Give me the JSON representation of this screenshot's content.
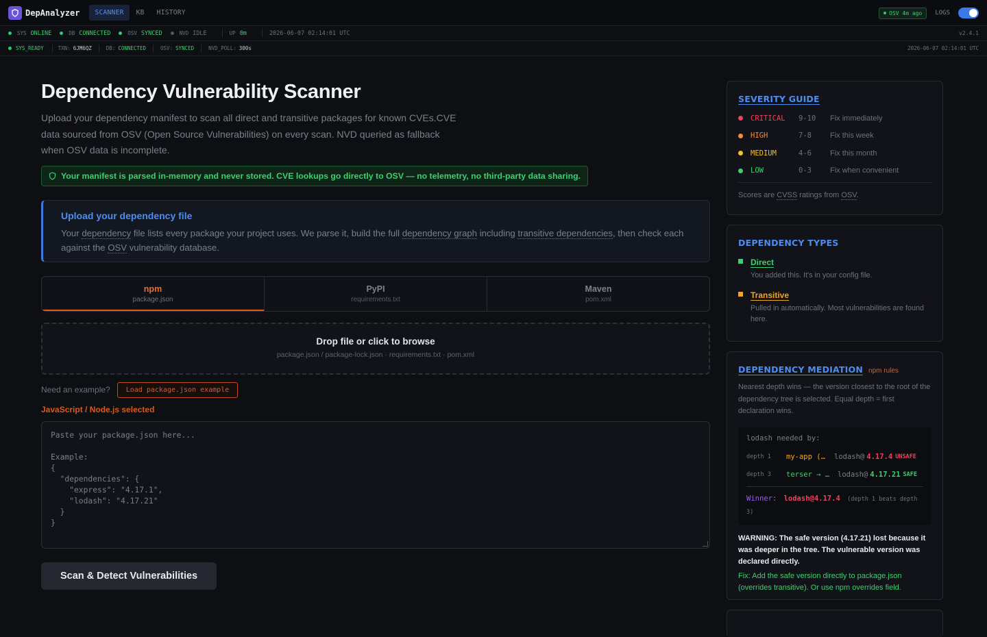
{
  "app": {
    "name": "DepAnalyzer"
  },
  "nav": {
    "tabs": [
      {
        "label": "SCANNER"
      },
      {
        "label": "KB"
      },
      {
        "label": "HISTORY"
      }
    ]
  },
  "top_right": {
    "osv_badge": "OSV 4m ago",
    "logs_label": "LOGS"
  },
  "status": {
    "sys_key": "SYS",
    "sys_val": "ONLINE",
    "db_key": "DB",
    "db_val": "CONNECTED",
    "osv_key": "OSV",
    "osv_val": "SYNCED",
    "nvd_key": "NVD",
    "nvd_val": "IDLE",
    "up_key": "UP",
    "up_val": "0m",
    "timestamp": "2026-06-07 02:14:01 UTC",
    "version": "v2.4.1"
  },
  "status2": {
    "ready": "SYS_READY",
    "txn_key": "TXN:",
    "txn_val": "6JM6QZ",
    "db_key": "DB:",
    "db_val": "CONNECTED",
    "osv_key": "OSV:",
    "osv_val": "SYNCED",
    "nvd_key": "NVD_POLL:",
    "nvd_val": "300s",
    "timestamp": "2026-06-07 02:14:01 UTC"
  },
  "main": {
    "title": "Dependency Vulnerability Scanner",
    "lead": "Upload your dependency manifest to scan all direct and transitive packages for known CVEs.CVE data sourced from OSV (Open Source Vulnerabilities) on every scan. NVD queried as fallback when OSV data is incomplete.",
    "privacy": "Your manifest is parsed in-memory and never stored. CVE lookups go directly to OSV — no telemetry, no third-party data sharing.",
    "upload": {
      "title": "Upload your dependency file",
      "p1": "Your ",
      "t1": "dependency",
      "p2": " file lists every package your project uses. We parse it, build the full ",
      "t2": "dependency graph",
      "p3": " including ",
      "t3": "transitive dependencies",
      "p4": ", then check each against the ",
      "t4": "OSV",
      "p5": " vulnerability database."
    },
    "ecosystems": [
      {
        "name": "npm",
        "file": "package.json"
      },
      {
        "name": "PyPI",
        "file": "requirements.txt"
      },
      {
        "name": "Maven",
        "file": "pom.xml"
      }
    ],
    "drop": {
      "title": "Drop file or click to browse",
      "sub": "package.json / package-lock.json · requirements.txt · pom.xml"
    },
    "example_q": "Need an example?",
    "example_btn": "Load package.json example",
    "selected": "JavaScript / Node.js selected",
    "placeholder": "Paste your package.json here...\n\nExample:\n{\n  \"dependencies\": {\n    \"express\": \"4.17.1\",\n    \"lodash\": \"4.17.21\"\n  }\n}",
    "scan_btn": "Scan & Detect Vulnerabilities"
  },
  "severity": {
    "title": "SEVERITY GUIDE",
    "rows": [
      {
        "name": "CRITICAL",
        "range": "9-10",
        "action": "Fix immediately",
        "color": "#f0405e"
      },
      {
        "name": "HIGH",
        "range": "7-8",
        "action": "Fix this week",
        "color": "#f58a3c"
      },
      {
        "name": "MEDIUM",
        "range": "4-6",
        "action": "Fix this month",
        "color": "#f2c12e"
      },
      {
        "name": "LOW",
        "range": "0-3",
        "action": "Fix when convenient",
        "color": "#3ecf6e"
      }
    ],
    "note_a": "Scores are ",
    "note_cvss": "CVSS",
    "note_b": " ratings from ",
    "note_osv": "OSV",
    "note_c": "."
  },
  "dep_types": {
    "title": "DEPENDENCY TYPES",
    "items": [
      {
        "name": "Direct",
        "desc": "You added this. It's in your config file.",
        "color": "#3ecf6e"
      },
      {
        "name": "Transitive",
        "desc": "Pulled in automatically. Most vulnerabilities are found here.",
        "color": "#f2a51e"
      }
    ]
  },
  "mediation": {
    "title": "DEPENDENCY MEDIATION",
    "badge": "npm rules",
    "desc": "Nearest depth wins — the version closest to the root of the dependency tree is selected. Equal depth = first declaration wins.",
    "code_head": "lodash needed by:",
    "rows": [
      {
        "depth": "depth 1",
        "from": "my-app (…",
        "pkg": "lodash@",
        "ver": "4.17.4",
        "tag": "UNSAFE"
      },
      {
        "depth": "depth 3",
        "from": "terser → …",
        "pkg": "lodash@",
        "ver": "4.17.21",
        "tag": "SAFE"
      }
    ],
    "winner_label": "Winner:",
    "winner_val": "lodash@4.17.4",
    "winner_note": "(depth 1 beats depth 3)",
    "warning": "WARNING: The safe version (4.17.21) lost because it was deeper in the tree. The vulnerable version was declared directly.",
    "fix": "Fix: Add the safe version directly to package.json (overrides transitive). Or use npm overrides field."
  }
}
